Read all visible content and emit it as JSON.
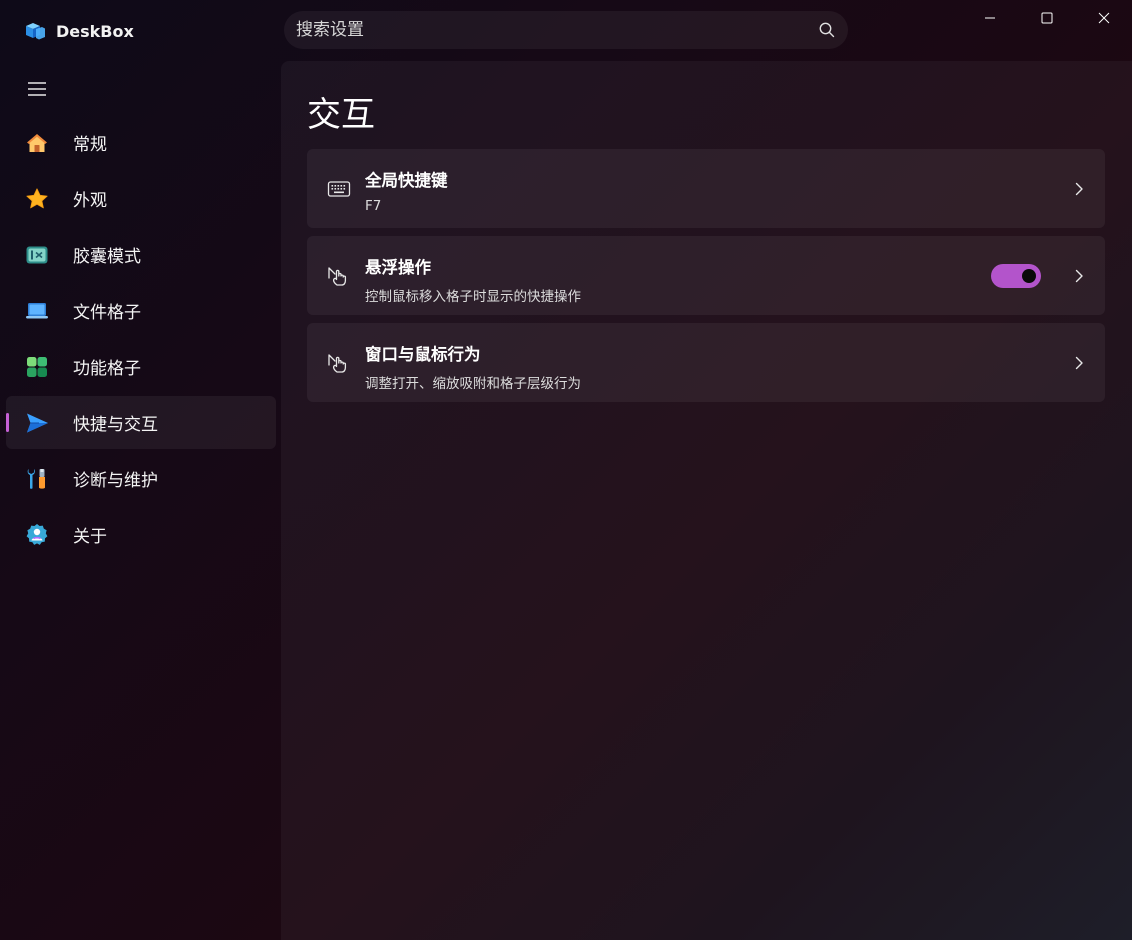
{
  "app": {
    "title": "DeskBox"
  },
  "search": {
    "placeholder": "搜索设置"
  },
  "sidebar": {
    "items": [
      {
        "label": "常规",
        "icon": "home-icon"
      },
      {
        "label": "外观",
        "icon": "star-icon"
      },
      {
        "label": "胶囊模式",
        "icon": "capsule-icon"
      },
      {
        "label": "文件格子",
        "icon": "laptop-icon"
      },
      {
        "label": "功能格子",
        "icon": "blocks-icon"
      },
      {
        "label": "快捷与交互",
        "icon": "send-icon",
        "selected": true
      },
      {
        "label": "诊断与维护",
        "icon": "tools-icon"
      },
      {
        "label": "关于",
        "icon": "about-icon"
      }
    ]
  },
  "page": {
    "title": "交互",
    "cards": [
      {
        "title": "全局快捷键",
        "subtitle": "F7",
        "icon": "keyboard-icon"
      },
      {
        "title": "悬浮操作",
        "subtitle": "控制鼠标移入格子时显示的快捷操作",
        "icon": "hover-hand-icon",
        "toggle_on": true
      },
      {
        "title": "窗口与鼠标行为",
        "subtitle": "调整打开、缩放吸附和格子层级行为",
        "icon": "hover-hand-icon"
      }
    ]
  },
  "colors": {
    "accent": "#b354cb",
    "indicator": "#c660d6"
  }
}
